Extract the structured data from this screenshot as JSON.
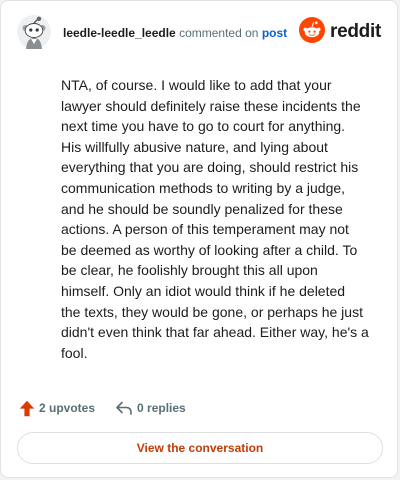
{
  "header": {
    "username": "leedle-leedle_leedle",
    "action_text": "commented on",
    "post_link": "post",
    "logo_text": "reddit"
  },
  "comment": {
    "lines": [
      "NTA, of course. I would like to add that your",
      "lawyer should definitely raise these incidents the",
      "next time you have to go to court for anything.",
      "His willfully abusive nature, and lying about",
      "everything that you are doing, should restrict his",
      "communication methods to writing by a judge,",
      "and he should be soundly penalized for these",
      "actions. A person of this temperament may not",
      "be deemed as worthy of looking after a child. To",
      "be clear, he foolishly brought this all upon",
      "himself. Only an idiot would think if he deleted",
      "the texts, they would be gone, or perhaps he just",
      "didn't even think that far ahead. Either way, he's a",
      "fool."
    ]
  },
  "actions": {
    "upvotes": "2 upvotes",
    "replies": "0 replies"
  },
  "footer": {
    "view_label": "View the conversation"
  },
  "icons": {
    "avatar": "snoo-avatar-icon",
    "logo": "reddit-logo-icon",
    "upvote": "upvote-arrow-icon",
    "reply": "reply-arrow-icon"
  },
  "colors": {
    "brand": "#ff4500",
    "upvote": "#d93a00",
    "link": "#0a63c9",
    "button_text": "#c23c05",
    "text": "#1c1c1c",
    "muted": "#576f76"
  }
}
